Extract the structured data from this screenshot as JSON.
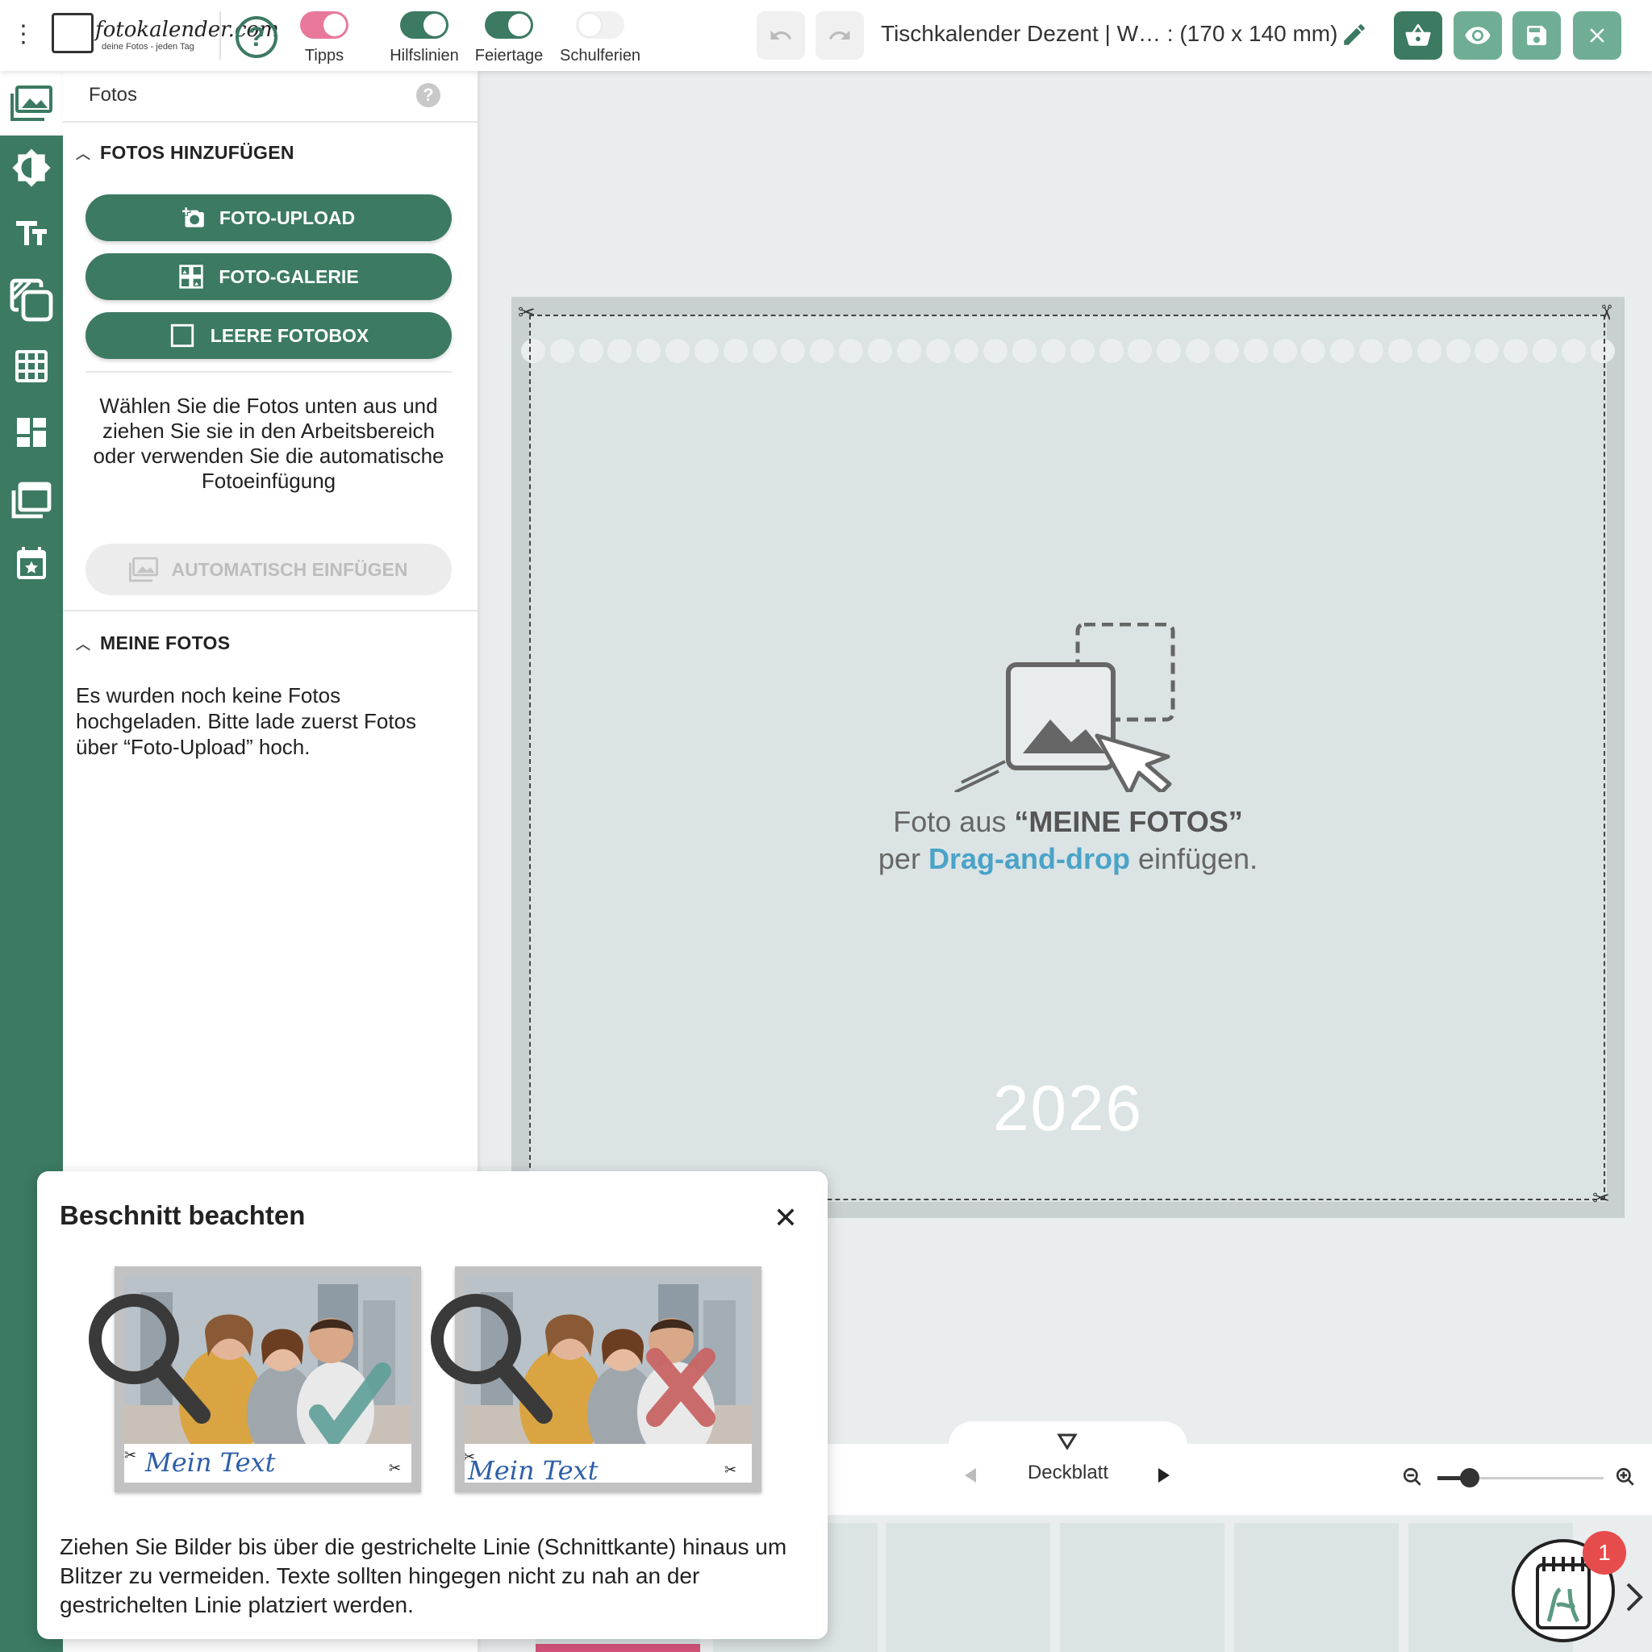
{
  "topbar": {
    "logo_text": "fotokalender.com",
    "logo_subtitle": "deine Fotos - jeden Tag",
    "toggles": [
      {
        "label": "Tipps",
        "state": "on",
        "color": "#e8799a"
      },
      {
        "label": "Hilfslinien",
        "state": "on",
        "color": "#3c7a62"
      },
      {
        "label": "Feiertage",
        "state": "on",
        "color": "#3c7a62"
      },
      {
        "label": "Schulferien",
        "state": "off",
        "color": "#f1f1f1"
      }
    ],
    "document_title": "Tischkalender Dezent | W… : (170 x 140 mm)"
  },
  "sidebar": {
    "items": [
      {
        "icon": "photos-icon",
        "active": true
      },
      {
        "icon": "filter-icon"
      },
      {
        "icon": "text-icon"
      },
      {
        "icon": "cliparts-icon"
      },
      {
        "icon": "grid-icon"
      },
      {
        "icon": "layout-icon"
      },
      {
        "icon": "background-icon"
      },
      {
        "icon": "calendar-star-icon"
      }
    ]
  },
  "panel": {
    "title": "Fotos",
    "add_section": {
      "heading": "FOTOS HINZUFÜGEN",
      "buttons": [
        "FOTO-UPLOAD",
        "FOTO-GALERIE",
        "LEERE FOTOBOX"
      ],
      "info": "Wählen Sie die Fotos unten aus und ziehen Sie sie in den Arbeitsbereich oder verwenden Sie die automatische Fotoeinfügung",
      "auto_button": "AUTOMATISCH EINFÜGEN"
    },
    "my_photos": {
      "heading": "MEINE FOTOS",
      "empty_text": "Es wurden noch keine Fotos hochgeladen. Bitte lade zuerst Fotos über “Foto-Upload” hoch."
    }
  },
  "canvas": {
    "drop_line1_pre": "Foto aus ",
    "drop_line1_bold": "“MEINE FOTOS”",
    "drop_line2_pre": "per ",
    "drop_line2_link": "Drag-and-drop",
    "drop_line2_post": " einfügen.",
    "year": "2026"
  },
  "navigation": {
    "page_label": "Deckblatt",
    "notification_count": "1"
  },
  "popup": {
    "title": "Beschnitt beachten",
    "example_caption": "Mein Text",
    "text": "Ziehen Sie Bilder bis über die gestrichelte Linie (Schnittkante) hinaus um Blitzer zu vermeiden. Texte sollten hingegen nicht zu nah an der gestrichelten Linie platziert werden."
  },
  "colors": {
    "brand_green": "#3c7a62",
    "accent_pink": "#e8799a",
    "link_blue": "#4aa3c8",
    "badge_red": "#e74c4c"
  }
}
